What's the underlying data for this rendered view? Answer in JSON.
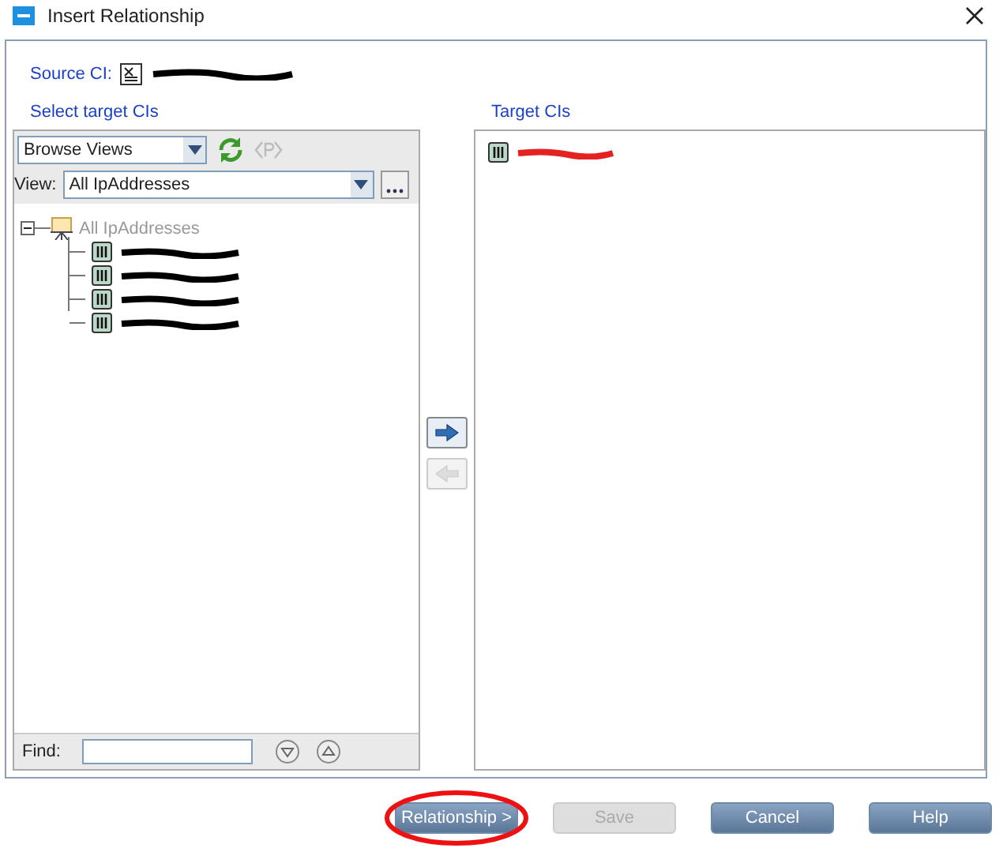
{
  "window": {
    "title": "Insert Relationship"
  },
  "source": {
    "label": "Source CI:"
  },
  "left_panel": {
    "title": "Select target CIs",
    "mode": {
      "value": "Browse Views"
    },
    "view": {
      "label": "View:",
      "value": "All IpAddresses"
    },
    "tree": {
      "label": "All IpAddresses",
      "expanded": true,
      "children": [
        {
          "kind": "redacted"
        },
        {
          "kind": "redacted"
        },
        {
          "kind": "redacted"
        },
        {
          "kind": "redacted"
        }
      ]
    },
    "find": {
      "label": "Find:"
    }
  },
  "move_buttons": [
    {
      "kind": "add",
      "disabled": false
    },
    {
      "kind": "remove",
      "disabled": true
    }
  ],
  "target_panel": {
    "title": "Target CIs",
    "items": [
      {
        "kind": "redacted"
      }
    ]
  },
  "buttons": [
    {
      "label": "Relationship >",
      "disabled": false,
      "circled": true
    },
    {
      "label": "Save",
      "disabled": true,
      "circled": false
    },
    {
      "label": "Cancel",
      "disabled": false,
      "circled": false
    },
    {
      "label": "Help",
      "disabled": false,
      "circled": false
    }
  ]
}
